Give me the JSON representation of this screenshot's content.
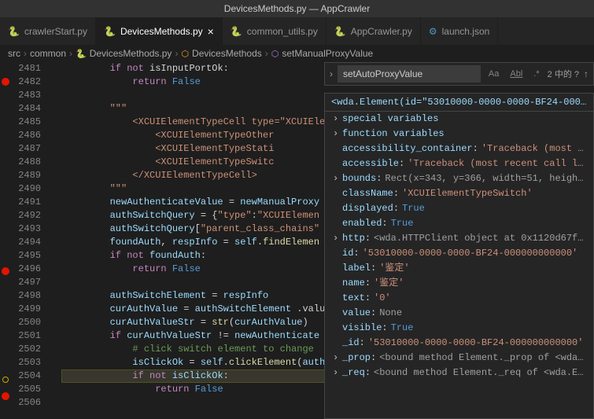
{
  "title": "DevicesMethods.py — AppCrawler",
  "tabs": [
    {
      "label": "crawlerStart.py",
      "icon": "py-icon",
      "active": false
    },
    {
      "label": "DevicesMethods.py",
      "icon": "py-icon",
      "active": true,
      "closeable": true
    },
    {
      "label": "common_utils.py",
      "icon": "py-icon",
      "active": false
    },
    {
      "label": "AppCrawler.py",
      "icon": "py-icon",
      "active": false
    },
    {
      "label": "launch.json",
      "icon": "json-icon",
      "active": false
    }
  ],
  "breadcrumbs": [
    {
      "label": "src"
    },
    {
      "label": "common"
    },
    {
      "label": "DevicesMethods.py",
      "icon": "py-icon"
    },
    {
      "label": "DevicesMethods",
      "icon": "sym-icon"
    },
    {
      "label": "setManualProxyValue",
      "icon": "meth-icon"
    }
  ],
  "search": {
    "value": "setAutoProxyValue",
    "results": "2 中的 ?"
  },
  "gutter": {
    "start": 2481,
    "end": 2506,
    "breakpoints": [
      2482,
      2496,
      2505
    ],
    "outline_breakpoints": [
      2504
    ],
    "highlighted": 2504
  },
  "code": {
    "2481": [
      [
        "",
        "        "
      ],
      [
        "kw",
        "if"
      ],
      [
        "",
        " "
      ],
      [
        "kw",
        "not"
      ],
      [
        "",
        " isInputPortOk:"
      ]
    ],
    "2482": [
      [
        "",
        "            "
      ],
      [
        "kw",
        "return"
      ],
      [
        "",
        " "
      ],
      [
        "bool",
        "False"
      ]
    ],
    "2483": [
      [
        "",
        ""
      ]
    ],
    "2484": [
      [
        "",
        "        "
      ],
      [
        "str",
        "\"\"\""
      ]
    ],
    "2485": [
      [
        "",
        "            "
      ],
      [
        "str",
        "<XCUIElementTypeCell type=\"XCUIElementTypeCell\" v"
      ]
    ],
    "2486": [
      [
        "",
        "                "
      ],
      [
        "str",
        "<XCUIElementTypeOther                         isib"
      ]
    ],
    "2487": [
      [
        "",
        "                "
      ],
      [
        "str",
        "<XCUIElementTypeStati                         =\"鉴定"
      ]
    ],
    "2488": [
      [
        "",
        "                "
      ],
      [
        "str",
        "<XCUIElementTypeSwitc                          \"鉴定"
      ]
    ],
    "2489": [
      [
        "",
        "            "
      ],
      [
        "str",
        "</XCUIElementTypeCell>"
      ]
    ],
    "2490": [
      [
        "",
        "        "
      ],
      [
        "str",
        "\"\"\""
      ]
    ],
    "2491": [
      [
        "",
        "        "
      ],
      [
        "var",
        "newAuthenticateValue"
      ],
      [
        "",
        " = "
      ],
      [
        "var",
        "newManualProxy"
      ]
    ],
    "2492": [
      [
        "",
        "        "
      ],
      [
        "var",
        "authSwitchQuery"
      ],
      [
        "",
        " = {"
      ],
      [
        "str",
        "\"type\""
      ],
      [
        "",
        ":"
      ],
      [
        "str",
        "\"XCUIElemen"
      ],
      [
        "",
        "                 "
      ],
      [
        "str",
        "\"}"
      ]
    ],
    "2493": [
      [
        "",
        "        "
      ],
      [
        "var",
        "authSwitchQuery"
      ],
      [
        "",
        "["
      ],
      [
        "str",
        "\"parent_class_chains\""
      ],
      [
        "",
        ""
      ]
    ],
    "2494": [
      [
        "",
        "        "
      ],
      [
        "var",
        "foundAuth"
      ],
      [
        "",
        ", "
      ],
      [
        "var",
        "respInfo"
      ],
      [
        "",
        " = "
      ],
      [
        "self",
        "self"
      ],
      [
        "",
        "."
      ],
      [
        "fn",
        "findElemen"
      ]
    ],
    "2495": [
      [
        "",
        "        "
      ],
      [
        "kw",
        "if"
      ],
      [
        "",
        " "
      ],
      [
        "kw",
        "not"
      ],
      [
        "",
        " "
      ],
      [
        "var",
        "foundAuth"
      ],
      [
        "",
        ":"
      ]
    ],
    "2496": [
      [
        "",
        "            "
      ],
      [
        "kw",
        "return"
      ],
      [
        "",
        " "
      ],
      [
        "bool",
        "False"
      ]
    ],
    "2497": [
      [
        "",
        ""
      ]
    ],
    "2498": [
      [
        "",
        "        "
      ],
      [
        "var",
        "authSwitchElement"
      ],
      [
        "",
        " = "
      ],
      [
        "var",
        "respInfo"
      ]
    ],
    "2499": [
      [
        "",
        "        "
      ],
      [
        "var",
        "curAuthValue"
      ],
      [
        "",
        " = "
      ],
      [
        "var",
        "authSwitchElement"
      ],
      [
        "",
        " .valu"
      ]
    ],
    "2500": [
      [
        "",
        "        "
      ],
      [
        "var",
        "curAuthValueStr"
      ],
      [
        "",
        " = "
      ],
      [
        "fn",
        "str"
      ],
      [
        "",
        "("
      ],
      [
        "var",
        "curAuthValue"
      ],
      [
        "",
        ")"
      ]
    ],
    "2501": [
      [
        "",
        "        "
      ],
      [
        "kw",
        "if"
      ],
      [
        "",
        " "
      ],
      [
        "var",
        "curAuthValueStr"
      ],
      [
        "",
        " != "
      ],
      [
        "var",
        "newAuthenticate"
      ]
    ],
    "2502": [
      [
        "",
        "            "
      ],
      [
        "cmt",
        "# click switch element to change "
      ]
    ],
    "2503": [
      [
        "",
        "            "
      ],
      [
        "var",
        "isClickOk"
      ],
      [
        "",
        " = "
      ],
      [
        "self",
        "self"
      ],
      [
        "",
        "."
      ],
      [
        "fn",
        "clickElement"
      ],
      [
        "",
        "("
      ],
      [
        "var",
        "authSwitchElement"
      ],
      [
        "",
        ")"
      ]
    ],
    "2504": [
      [
        "",
        "            "
      ],
      [
        "kw",
        "if"
      ],
      [
        "",
        " "
      ],
      [
        "kw",
        "not"
      ],
      [
        "",
        " "
      ],
      [
        "var",
        "isClickOk"
      ],
      [
        "",
        ":"
      ]
    ],
    "2505": [
      [
        "",
        "                "
      ],
      [
        "kw",
        "return"
      ],
      [
        "",
        " "
      ],
      [
        "bool",
        "False"
      ]
    ],
    "2506": [
      [
        "",
        ""
      ]
    ]
  },
  "debug": {
    "header": "<wda.Element(id=\"53010000-0000-0000-BF24-0000…",
    "rows": [
      {
        "expandable": true,
        "key": "special variables",
        "val": "",
        "type": "obj"
      },
      {
        "expandable": true,
        "key": "function variables",
        "val": "",
        "type": "obj"
      },
      {
        "expandable": false,
        "key": "accessibility_container",
        "val": "'Traceback (most …",
        "type": "str"
      },
      {
        "expandable": false,
        "key": "accessible",
        "val": "'Traceback (most recent call l…",
        "type": "str"
      },
      {
        "expandable": true,
        "key": "bounds",
        "val": "Rect(x=343, y=366, width=51, heigh…",
        "type": "obj"
      },
      {
        "expandable": false,
        "key": "className",
        "val": "'XCUIElementTypeSwitch'",
        "type": "str"
      },
      {
        "expandable": false,
        "key": "displayed",
        "val": "True",
        "type": "bool"
      },
      {
        "expandable": false,
        "key": "enabled",
        "val": "True",
        "type": "bool"
      },
      {
        "expandable": true,
        "key": "http",
        "val": "<wda.HTTPClient object at 0x1120d67f…",
        "type": "obj"
      },
      {
        "expandable": false,
        "key": "id",
        "val": "'53010000-0000-0000-BF24-000000000000'",
        "type": "str"
      },
      {
        "expandable": false,
        "key": "label",
        "val": "'鉴定'",
        "type": "str"
      },
      {
        "expandable": false,
        "key": "name",
        "val": "'鉴定'",
        "type": "str"
      },
      {
        "expandable": false,
        "key": "text",
        "val": "'0'",
        "type": "str"
      },
      {
        "expandable": false,
        "key": "value",
        "val": "None",
        "type": "none"
      },
      {
        "expandable": false,
        "key": "visible",
        "val": "True",
        "type": "bool"
      },
      {
        "expandable": false,
        "key": "_id",
        "val": "'53010000-0000-0000-BF24-000000000000'",
        "type": "str"
      },
      {
        "expandable": true,
        "key": "_prop",
        "val": "<bound method Element._prop of <wda…",
        "type": "obj"
      },
      {
        "expandable": true,
        "key": "_req",
        "val": "<bound method Element._req of <wda.E…",
        "type": "obj"
      }
    ]
  }
}
